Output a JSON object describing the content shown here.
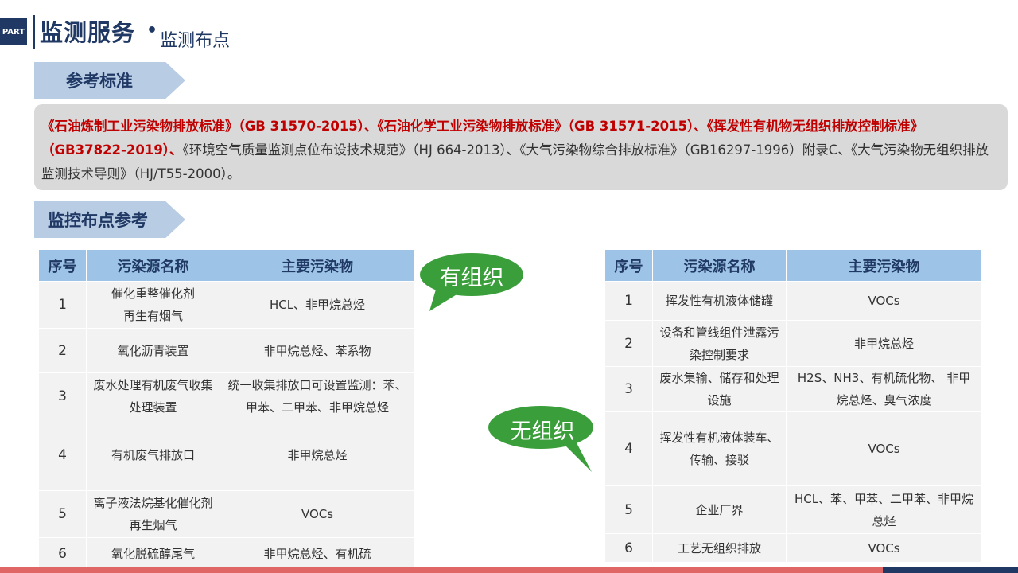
{
  "header": {
    "badge": "PART",
    "title": "监测服务",
    "dot": "•",
    "subtitle": "监测布点"
  },
  "reference": {
    "label": "参考标准",
    "red_text": "《石油炼制工业污染物排放标准》（GB 31570-2015）、《石油化学工业污染物排放标准》（GB 31571-2015）、《挥发性有机物无组织排放控制标准》（GB37822-2019）、",
    "normal_text": "《环境空气质量监测点位布设技术规范》（HJ 664-2013）、《大气污染物综合排放标准》（GB16297-1996）附录C、《大气污染物无组织排放监测技术导则》（HJ/T55-2000）。"
  },
  "monitoring": {
    "label": "监控布点参考"
  },
  "bubbles": {
    "organized": "有组织",
    "unorganized": "无组织"
  },
  "colors": {
    "primary": "#1f3864",
    "accent_red": "#c00000",
    "bubble_green": "#3a9e3a",
    "header_blue": "#9dc3e6",
    "cell_gray": "#f2f2f2"
  },
  "left_table": {
    "headers": [
      "序号",
      "污染源名称",
      "主要污染物"
    ],
    "rows": [
      {
        "no": "1",
        "source_l1": "催化重整催化剂",
        "source_l2": "再生有烟气",
        "pollutant_l1": "HCL、非甲烷总烃",
        "pollutant_l2": ""
      },
      {
        "no": "2",
        "source_l1": "氧化沥青装置",
        "source_l2": "",
        "pollutant_l1": "非甲烷总烃、苯系物",
        "pollutant_l2": ""
      },
      {
        "no": "3",
        "source_l1": "废水处理有机废气收集",
        "source_l2": "处理装置",
        "pollutant_l1": "统一收集排放口可设置监测：苯、",
        "pollutant_l2": "甲苯、二甲苯、非甲烷总烃"
      },
      {
        "no": "4",
        "source_l1": "有机废气排放口",
        "source_l2": "",
        "pollutant_l1": "非甲烷总烃",
        "pollutant_l2": ""
      },
      {
        "no": "5",
        "source_l1": "离子液法烷基化催化剂",
        "source_l2": "再生烟气",
        "pollutant_l1": "VOCs",
        "pollutant_l2": ""
      },
      {
        "no": "6",
        "source_l1": "氧化脱硫醇尾气",
        "source_l2": "",
        "pollutant_l1": "非甲烷总烃、有机硫",
        "pollutant_l2": ""
      }
    ]
  },
  "right_table": {
    "headers": [
      "序号",
      "污染源名称",
      "主要污染物"
    ],
    "rows": [
      {
        "no": "1",
        "source_l1": "挥发性有机液体储罐",
        "source_l2": "",
        "pollutant_l1": "VOCs",
        "pollutant_l2": ""
      },
      {
        "no": "2",
        "source_l1": "设备和管线组件泄露污",
        "source_l2": "染控制要求",
        "pollutant_l1": "非甲烷总烃",
        "pollutant_l2": ""
      },
      {
        "no": "3",
        "source_l1": "废水集输、储存和处理",
        "source_l2": "设施",
        "pollutant_l1": "H2S、NH3、有机硫化物、 非甲",
        "pollutant_l2": "烷总烃、臭气浓度"
      },
      {
        "no": "4",
        "source_l1": "挥发性有机液体装车、",
        "source_l2": "传输、接驳",
        "pollutant_l1": "VOCs",
        "pollutant_l2": ""
      },
      {
        "no": "5",
        "source_l1": "企业厂界",
        "source_l2": "",
        "pollutant_l1": "HCL、苯、甲苯、二甲苯、非甲烷",
        "pollutant_l2": "总烃"
      },
      {
        "no": "6",
        "source_l1": "工艺无组织排放",
        "source_l2": "",
        "pollutant_l1": "VOCs",
        "pollutant_l2": ""
      }
    ]
  }
}
